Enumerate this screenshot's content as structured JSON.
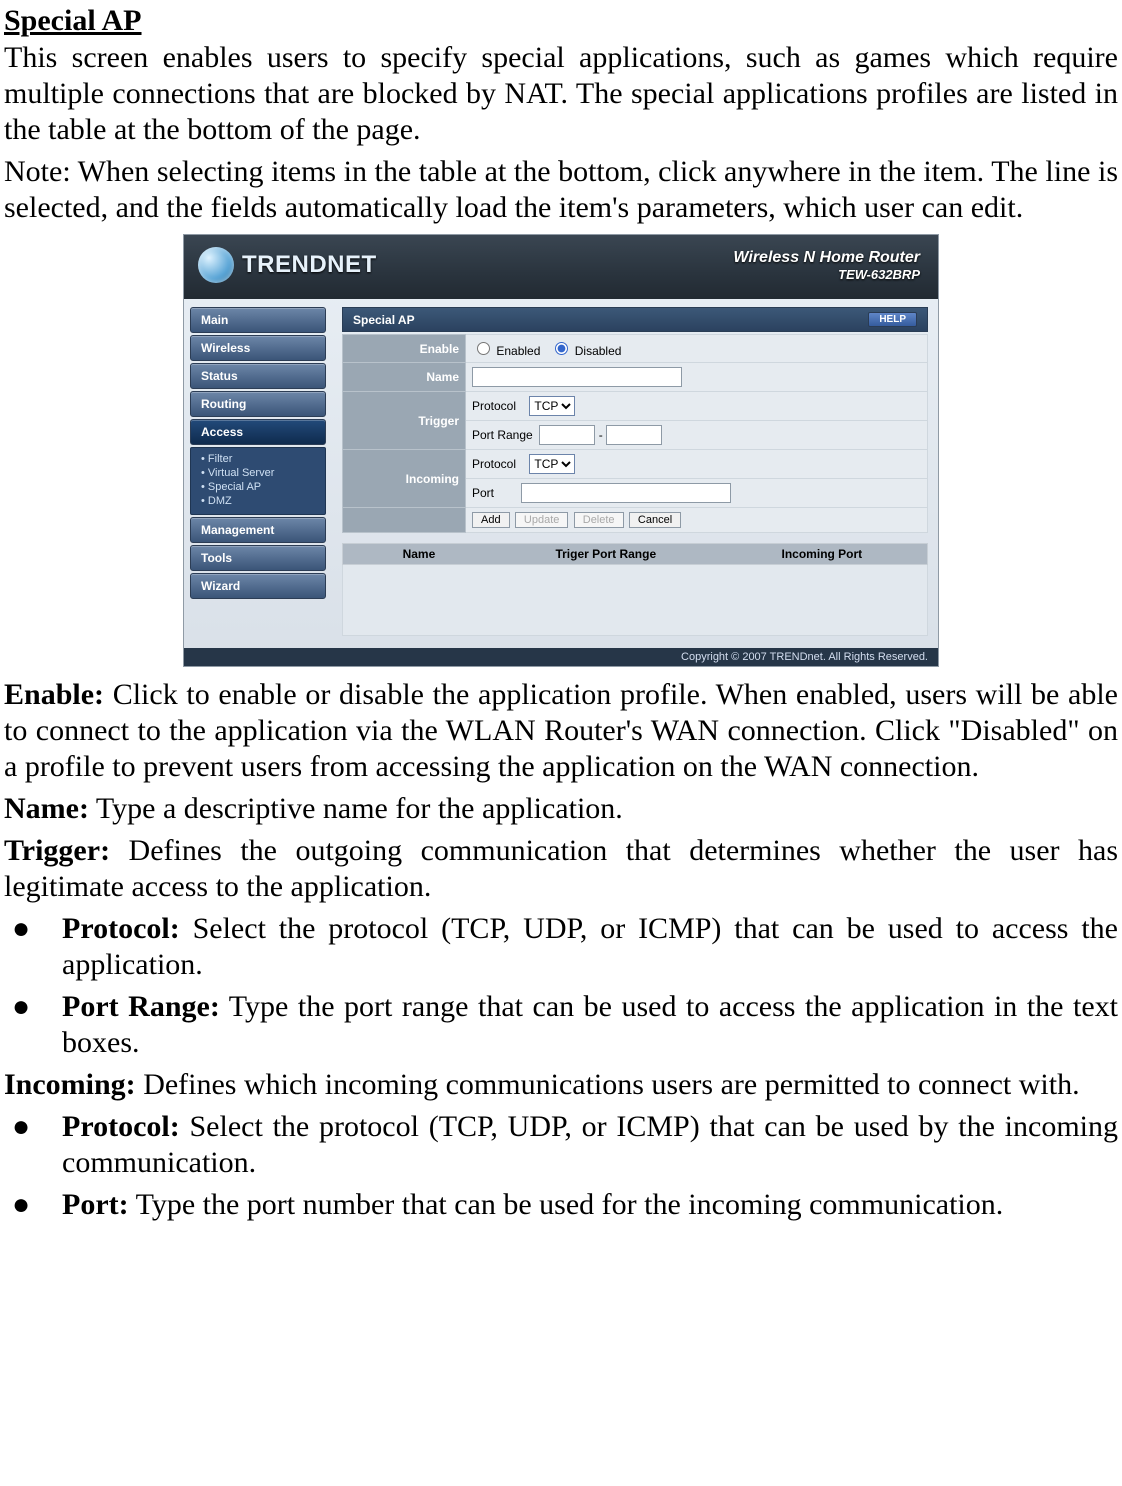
{
  "doc": {
    "title": "Special AP",
    "intro": "This screen enables users to specify special applications, such as games which require multiple connections that are blocked by NAT. The special applications profiles are listed in the table at the bottom of the page.",
    "note": "Note: When selecting items in the table at the bottom, click anywhere in the item. The line is selected, and the fields automatically load the item's parameters, which user can edit.",
    "fields": {
      "enable_label": "Enable:",
      "enable_desc": " Click to enable or disable the application profile. When enabled, users will be able to connect to the application via the WLAN Router's WAN connection. Click \"Disabled\" on a profile to prevent users from accessing the application on the WAN connection.",
      "name_label": "Name:",
      "name_desc": " Type a descriptive name for the application.",
      "trigger_label": "Trigger:",
      "trigger_desc": " Defines the outgoing communication that determines whether the user has legitimate access to the application.",
      "trigger_protocol_label": "Protocol:",
      "trigger_protocol_desc": " Select the protocol (TCP, UDP, or ICMP) that can be used to access the application.",
      "trigger_portrange_label": "Port Range:",
      "trigger_portrange_desc": " Type the port range that can be used to access the application in the text boxes.",
      "incoming_label": "Incoming:",
      "incoming_desc": " Defines which incoming communications users are permitted to connect with.",
      "incoming_protocol_label": "Protocol:",
      "incoming_protocol_desc": " Select the protocol (TCP, UDP, or ICMP) that can be used by the incoming communication.",
      "incoming_port_label": "Port:",
      "incoming_port_desc": " Type the port number that can be used for the incoming communication."
    }
  },
  "router": {
    "brand": "TRENDNET",
    "product_line1": "Wireless N Home Router",
    "product_line2": "TEW-632BRP",
    "nav": [
      "Main",
      "Wireless",
      "Status",
      "Routing",
      "Access",
      "Management",
      "Tools",
      "Wizard"
    ],
    "subnav": [
      "Filter",
      "Virtual Server",
      "Special AP",
      "DMZ"
    ],
    "panel_title": "Special AP",
    "help": "HELP",
    "labels": {
      "enable": "Enable",
      "enabled": "Enabled",
      "disabled": "Disabled",
      "name": "Name",
      "trigger": "Trigger",
      "incoming": "Incoming",
      "protocol": "Protocol",
      "portrange": "Port Range",
      "port": "Port"
    },
    "buttons": {
      "add": "Add",
      "update": "Update",
      "delete": "Delete",
      "cancel": "Cancel"
    },
    "protocol_value": "TCP",
    "list_headers": {
      "name": "Name",
      "trigger": "Triger Port Range",
      "incoming": "Incoming Port"
    },
    "footer": "Copyright © 2007 TRENDnet. All Rights Reserved."
  }
}
